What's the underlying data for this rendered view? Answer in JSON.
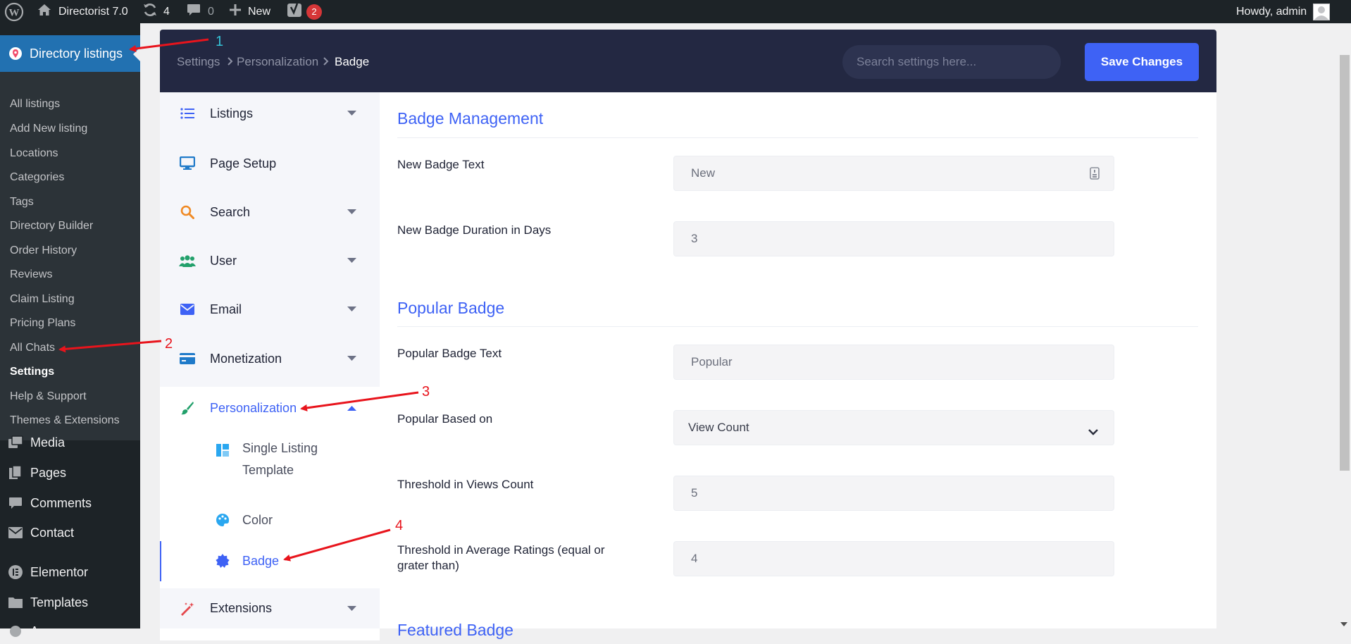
{
  "admin_bar": {
    "site_name": "Directorist 7.0",
    "updates_count": "4",
    "comments_count": "0",
    "new_label": "New",
    "yoast_count": "2",
    "greeting": "Howdy, admin"
  },
  "sidebar": {
    "current_menu": "Directory listings",
    "submenu": [
      "All listings",
      "Add New listing",
      "Locations",
      "Categories",
      "Tags",
      "Directory Builder",
      "Order History",
      "Reviews",
      "Claim Listing",
      "Pricing Plans",
      "All Chats",
      "Settings",
      "Help & Support",
      "Themes & Extensions"
    ],
    "menu": [
      "Media",
      "Pages",
      "Comments",
      "Contact",
      "Elementor",
      "Templates",
      "A..."
    ]
  },
  "header": {
    "breadcrumb": [
      "Settings",
      "Personalization",
      "Badge"
    ],
    "search_placeholder": "Search settings here...",
    "save_label": "Save Changes"
  },
  "nav": {
    "items": [
      "Listings",
      "Page Setup",
      "Search",
      "User",
      "Email",
      "Monetization",
      "Personalization",
      "Extensions"
    ],
    "sub_items": [
      "Single Listing Template",
      "Color",
      "Badge"
    ]
  },
  "content": {
    "section1_title": "Badge Management",
    "new_badge_text_label": "New Badge Text",
    "new_badge_text_value": "New",
    "new_badge_duration_label": "New Badge Duration in Days",
    "new_badge_duration_value": "3",
    "section2_title": "Popular Badge",
    "popular_badge_text_label": "Popular Badge Text",
    "popular_badge_text_value": "Popular",
    "popular_based_on_label": "Popular Based on",
    "popular_based_on_value": "View Count",
    "threshold_views_label": "Threshold in Views Count",
    "threshold_views_value": "5",
    "threshold_ratings_label": "Threshold in Average Ratings (equal or grater than)",
    "threshold_ratings_value": "4",
    "section3_title_partial": "Featured Badge"
  },
  "annotations": [
    "1",
    "2",
    "3",
    "4"
  ],
  "colors": {
    "adminbar_bg": "#1d2327",
    "sidebar_current": "#2271b1",
    "header_bg": "#232842",
    "accent": "#3e62f5",
    "arrow": "#e8141c"
  }
}
